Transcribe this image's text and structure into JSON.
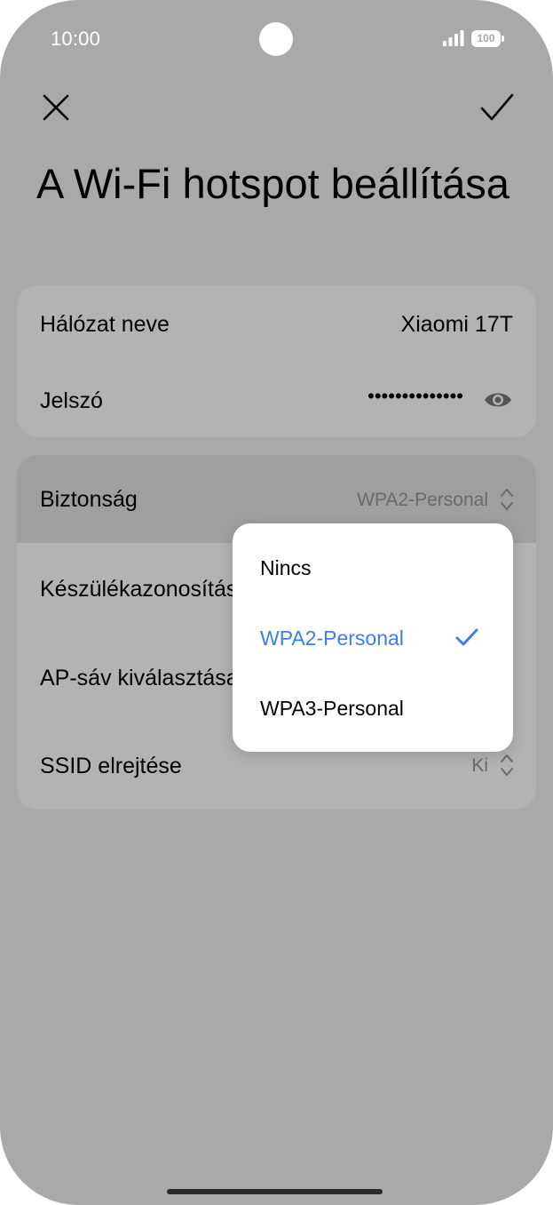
{
  "status_bar": {
    "time": "10:00",
    "battery": "100"
  },
  "header": {
    "title": "A Wi-Fi hotspot beállítása",
    "close_icon": "close-icon",
    "confirm_icon": "check-icon"
  },
  "network_card": {
    "name_label": "Hálózat neve",
    "name_value": "Xiaomi 17T",
    "password_label": "Jelszó",
    "password_value": "••••••••••••••",
    "visibility_icon": "eye-icon"
  },
  "settings_card": {
    "security_label": "Biztonság",
    "security_value": "WPA2-Personal",
    "device_id_label": "Készülékazonosítás",
    "ap_band_label": "AP-sáv kiválasztása",
    "hide_ssid_label": "SSID elrejtése",
    "hide_ssid_value": "Ki"
  },
  "dropdown": {
    "options": [
      {
        "label": "Nincs",
        "selected": false
      },
      {
        "label": "WPA2-Personal",
        "selected": true
      },
      {
        "label": "WPA3-Personal",
        "selected": false
      }
    ]
  },
  "colors": {
    "accent": "#3a80e8",
    "dim_background": "#a9a9a9"
  }
}
